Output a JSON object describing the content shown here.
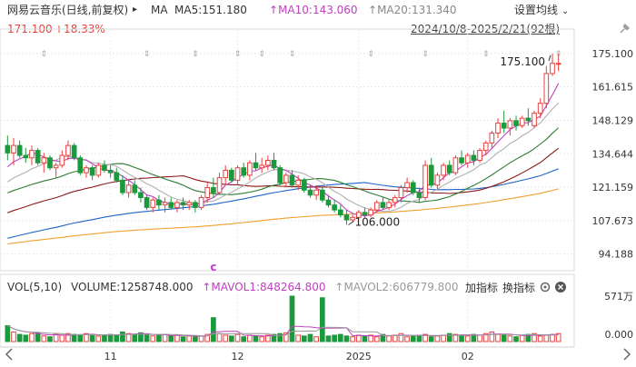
{
  "header": {
    "stock_name": "网易云音乐(日线,前复权)",
    "arrow": "▸",
    "ma_label": "MA",
    "ma5": "MA5:151.180",
    "ma10": "MA10:143.060",
    "ma20": "MA20:131.340",
    "settings_label": "设置均线",
    "price": "171.100",
    "change": "+18.33%",
    "range": "2024/10/8-2025/2/21(92根)"
  },
  "volume_header": {
    "vol_label": "VOL(5,10)",
    "volume": "VOLUME:1258748.000",
    "mavol1": "MAVOL1:848264.800",
    "mavol2": "MAVOL2:606779.800",
    "add_indicator": "加指标",
    "switch_indicator": "换指标"
  },
  "colors": {
    "up": "#e8413e",
    "down": "#1a9a3c",
    "ma5": "#bf40bf",
    "ma10": "#b0b0b0",
    "ma20": "#2e7d32",
    "ma30": "#8b1a1a",
    "ma60": "#1e63c8",
    "ma120": "#f0a030"
  },
  "chart_data": [
    {
      "type": "candlestick",
      "ylim": [
        87.5,
        182
      ],
      "y_ticks": [
        "175.100",
        "161.615",
        "148.129",
        "134.644",
        "121.159",
        "107.673",
        "94.188"
      ],
      "x_ticks": [
        "11",
        "12",
        "2025",
        "02"
      ],
      "annotations": {
        "high": "175.100",
        "low": "106.000",
        "marker": "c"
      },
      "ohlc": [
        [
          138,
          142,
          132,
          135
        ],
        [
          135,
          141,
          130,
          138
        ],
        [
          138,
          140,
          133,
          134
        ],
        [
          134,
          137,
          131,
          133
        ],
        [
          133,
          138,
          130,
          136
        ],
        [
          136,
          137,
          130,
          131
        ],
        [
          131,
          135,
          127,
          133
        ],
        [
          133,
          134,
          128,
          129
        ],
        [
          129,
          131,
          125,
          130
        ],
        [
          130,
          136,
          129,
          134
        ],
        [
          134,
          140,
          132,
          138
        ],
        [
          138,
          139,
          132,
          133
        ],
        [
          133,
          134,
          126,
          127
        ],
        [
          127,
          130,
          125,
          129
        ],
        [
          129,
          130,
          124,
          126
        ],
        [
          126,
          131,
          125,
          130
        ],
        [
          130,
          132,
          127,
          128
        ],
        [
          128,
          130,
          125,
          127
        ],
        [
          127,
          129,
          123,
          124
        ],
        [
          124,
          126,
          118,
          119
        ],
        [
          119,
          124,
          117,
          122
        ],
        [
          122,
          124,
          118,
          119
        ],
        [
          119,
          121,
          115,
          117
        ],
        [
          117,
          118,
          112,
          113
        ],
        [
          113,
          117,
          111,
          116
        ],
        [
          116,
          118,
          112,
          114
        ],
        [
          114,
          117,
          111,
          115
        ],
        [
          115,
          117,
          112,
          113
        ],
        [
          113,
          116,
          111,
          115
        ],
        [
          115,
          117,
          112,
          114
        ],
        [
          114,
          116,
          112,
          115
        ],
        [
          115,
          116,
          111,
          113
        ],
        [
          113,
          118,
          112,
          117
        ],
        [
          117,
          123,
          115,
          121
        ],
        [
          121,
          125,
          117,
          119
        ],
        [
          119,
          127,
          118,
          125
        ],
        [
          125,
          130,
          122,
          128
        ],
        [
          128,
          129,
          123,
          124
        ],
        [
          124,
          130,
          122,
          129
        ],
        [
          129,
          131,
          125,
          126
        ],
        [
          126,
          132,
          124,
          131
        ],
        [
          131,
          135,
          128,
          129
        ],
        [
          129,
          133,
          127,
          130
        ],
        [
          130,
          134,
          128,
          132
        ],
        [
          132,
          135,
          128,
          129
        ],
        [
          129,
          130,
          122,
          123
        ],
        [
          123,
          127,
          121,
          126
        ],
        [
          126,
          128,
          121,
          122
        ],
        [
          122,
          126,
          120,
          124
        ],
        [
          124,
          125,
          119,
          120
        ],
        [
          120,
          122,
          117,
          118
        ],
        [
          118,
          122,
          116,
          120
        ],
        [
          120,
          121,
          115,
          116
        ],
        [
          116,
          118,
          113,
          114
        ],
        [
          114,
          116,
          111,
          112
        ],
        [
          112,
          114,
          109,
          110
        ],
        [
          110,
          112,
          106,
          108
        ],
        [
          108,
          110,
          107,
          109
        ],
        [
          109,
          112,
          108,
          111
        ],
        [
          111,
          113,
          109,
          110
        ],
        [
          110,
          113,
          109,
          112
        ],
        [
          112,
          116,
          111,
          115
        ],
        [
          115,
          117,
          112,
          113
        ],
        [
          113,
          116,
          112,
          115
        ],
        [
          115,
          118,
          113,
          117
        ],
        [
          117,
          122,
          115,
          121
        ],
        [
          121,
          125,
          119,
          123
        ],
        [
          123,
          124,
          118,
          119
        ],
        [
          119,
          121,
          115,
          117
        ],
        [
          117,
          132,
          116,
          130
        ],
        [
          130,
          133,
          121,
          122
        ],
        [
          122,
          127,
          120,
          126
        ],
        [
          126,
          131,
          124,
          130
        ],
        [
          130,
          132,
          126,
          127
        ],
        [
          127,
          134,
          126,
          133
        ],
        [
          133,
          136,
          130,
          131
        ],
        [
          131,
          135,
          129,
          134
        ],
        [
          134,
          136,
          130,
          132
        ],
        [
          132,
          137,
          131,
          136
        ],
        [
          136,
          140,
          134,
          139
        ],
        [
          139,
          144,
          137,
          143
        ],
        [
          143,
          149,
          141,
          147
        ],
        [
          147,
          152,
          143,
          145
        ],
        [
          145,
          149,
          142,
          148
        ],
        [
          148,
          150,
          144,
          146
        ],
        [
          146,
          150,
          145,
          149
        ],
        [
          149,
          153,
          146,
          148
        ],
        [
          146,
          152,
          145,
          151
        ],
        [
          151,
          157,
          149,
          155
        ],
        [
          155,
          170,
          153,
          167
        ],
        [
          167,
          175.1,
          166,
          171.1
        ],
        [
          171.1,
          175.1,
          168,
          171.1
        ]
      ],
      "volume_max_label": "571万",
      "volume_zero_label": "0.000",
      "volume": [
        20,
        12,
        9,
        8,
        10,
        11,
        7,
        6,
        9,
        8,
        10,
        9,
        8,
        10,
        9,
        7,
        8,
        9,
        8,
        12,
        10,
        9,
        11,
        8,
        7,
        8,
        9,
        7,
        8,
        6,
        7,
        6,
        7,
        9,
        30,
        10,
        8,
        7,
        9,
        6,
        8,
        7,
        6,
        8,
        9,
        10,
        11,
        57,
        8,
        7,
        9,
        6,
        55,
        7,
        8,
        9,
        7,
        6,
        8,
        7,
        8,
        6,
        9,
        7,
        8,
        10,
        6,
        7,
        8,
        9,
        6,
        7,
        8,
        10,
        9,
        8,
        7,
        9,
        8,
        10,
        12,
        9,
        8,
        7,
        6,
        8,
        9,
        10,
        7,
        8,
        9,
        10
      ]
    }
  ]
}
